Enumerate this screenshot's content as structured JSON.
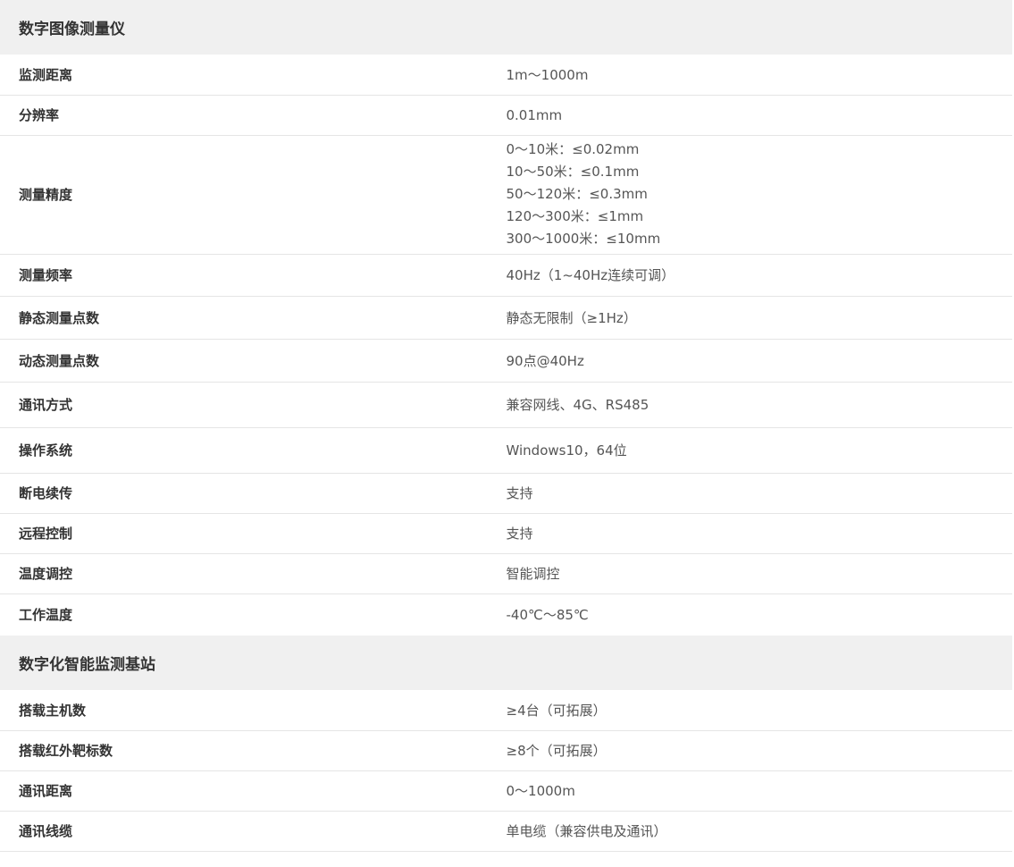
{
  "sections": [
    {
      "title": "数字图像测量仪",
      "rows": [
        {
          "label": "监测距离",
          "value": "1m～1000m"
        },
        {
          "label": "分辨率",
          "value": "0.01mm"
        },
        {
          "label": "测量精度",
          "lines": [
            "0～10米：≤0.02mm",
            "10～50米：≤0.1mm",
            "50～120米：≤0.3mm",
            "120～300米：≤1mm",
            "300～1000米：≤10mm"
          ]
        },
        {
          "label": "测量频率",
          "value": "40Hz（1~40Hz连续可调）"
        },
        {
          "label": "静态测量点数",
          "value": "静态无限制（≥1Hz）"
        },
        {
          "label": "动态测量点数",
          "value": "90点@40Hz"
        },
        {
          "label": "通讯方式",
          "value": "兼容网线、4G、RS485"
        },
        {
          "label": "操作系统",
          "value": "Windows10，64位"
        },
        {
          "label": "断电续传",
          "value": "支持"
        },
        {
          "label": "远程控制",
          "value": "支持"
        },
        {
          "label": "温度调控",
          "value": "智能调控"
        },
        {
          "label": "工作温度",
          "value": "-40℃～85℃"
        }
      ]
    },
    {
      "title": "数字化智能监测基站",
      "rows": [
        {
          "label": "搭载主机数",
          "value": "≥4台（可拓展）"
        },
        {
          "label": "搭载红外靶标数",
          "value": "≥8个（可拓展）"
        },
        {
          "label": "通讯距离",
          "value": "0～1000m"
        },
        {
          "label": "通讯线缆",
          "value": "单电缆（兼容供电及通讯）"
        }
      ]
    }
  ]
}
